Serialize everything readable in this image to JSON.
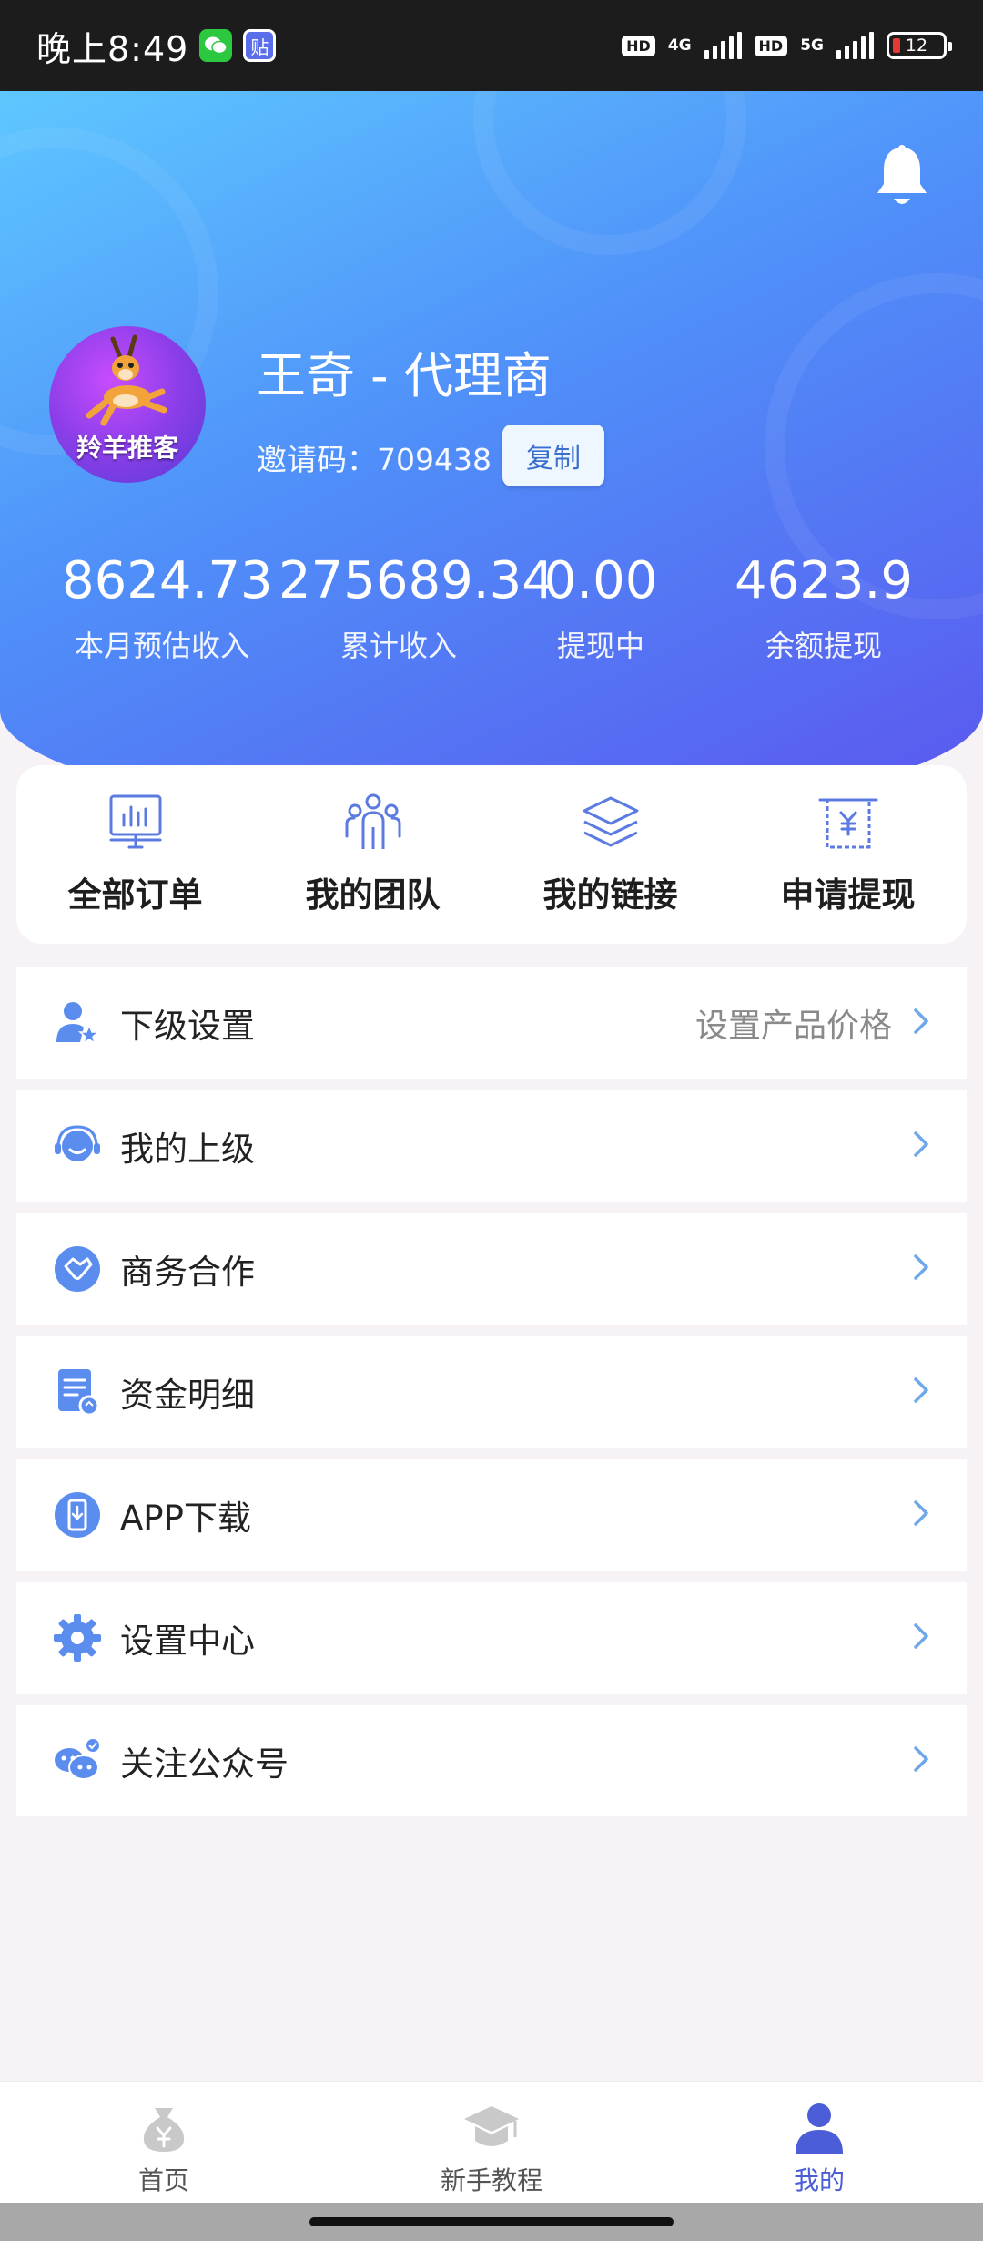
{
  "status_bar": {
    "time": "晚上8:49",
    "wechat_icon": "wechat-icon",
    "tieba_label": "贴",
    "hd1": "HD",
    "net1": "4G",
    "hd2": "HD",
    "net2": "5G",
    "battery": "12"
  },
  "header": {
    "avatar_text": "羚羊推客",
    "username": "王奇 - 代理商",
    "invite_label": "邀请码：709438",
    "copy_button": "复制",
    "bell_icon": "bell-icon",
    "stats": [
      {
        "value": "8624.73",
        "label": "本月预估收入"
      },
      {
        "value": "275689.34",
        "label": "累计收入"
      },
      {
        "value": "0.00",
        "label": "提现中"
      },
      {
        "value": "4623.9",
        "label": "余额提现"
      }
    ]
  },
  "shortcuts": [
    {
      "label": "全部订单",
      "icon": "chart-board-icon"
    },
    {
      "label": "我的团队",
      "icon": "team-icon"
    },
    {
      "label": "我的链接",
      "icon": "layers-icon"
    },
    {
      "label": "申请提现",
      "icon": "yen-receipt-icon"
    }
  ],
  "menu": [
    {
      "label": "下级设置",
      "hint": "设置产品价格",
      "icon": "user-star-icon"
    },
    {
      "label": "我的上级",
      "hint": "",
      "icon": "headset-icon"
    },
    {
      "label": "商务合作",
      "hint": "",
      "icon": "handshake-icon"
    },
    {
      "label": "资金明细",
      "hint": "",
      "icon": "document-icon"
    },
    {
      "label": "APP下载",
      "hint": "",
      "icon": "phone-download-icon"
    },
    {
      "label": "设置中心",
      "hint": "",
      "icon": "gear-icon"
    },
    {
      "label": "关注公众号",
      "hint": "",
      "icon": "chat-bubbles-icon"
    }
  ],
  "tabbar": [
    {
      "label": "首页",
      "icon": "money-bag-icon",
      "active": false
    },
    {
      "label": "新手教程",
      "icon": "graduation-cap-icon",
      "active": false
    },
    {
      "label": "我的",
      "icon": "person-icon",
      "active": true
    }
  ],
  "colors": {
    "accent": "#4b5ed8",
    "icon_blue": "#5b8def",
    "chevron": "#6fa8e8"
  }
}
